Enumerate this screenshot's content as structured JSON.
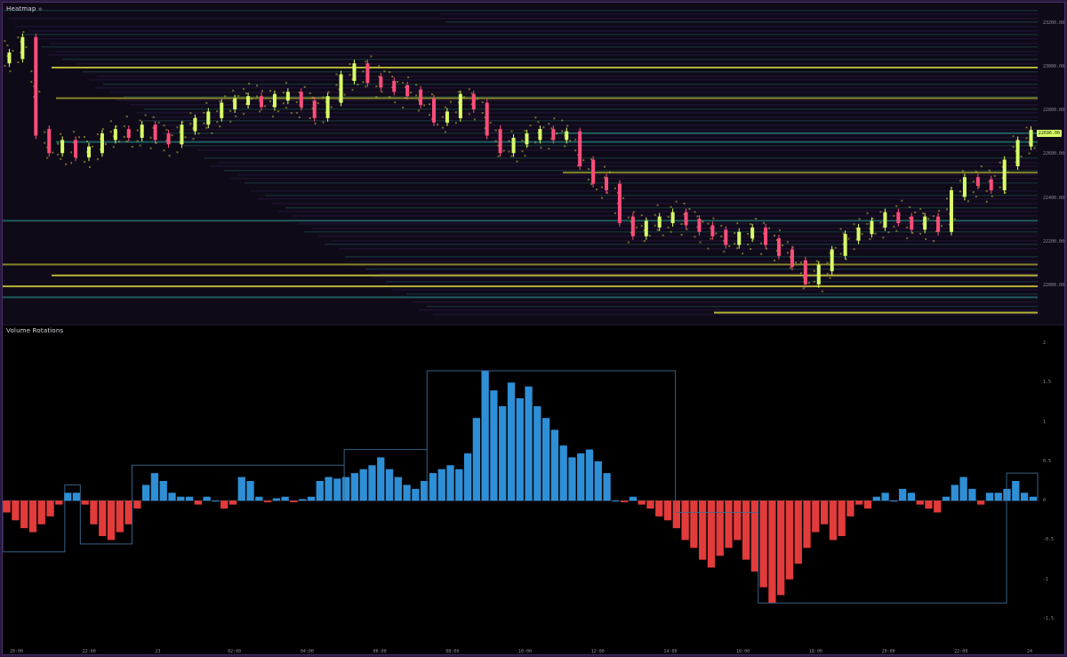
{
  "heatmap": {
    "title": "Heatmap",
    "title_icon": "settings-icon",
    "price_axis": [
      "23200.00",
      "23000.00",
      "22800.00",
      "22600.00",
      "22400.00",
      "22200.00",
      "22000.00"
    ],
    "current_price": "22696.00",
    "colors": {
      "background": "#0f0a18",
      "liquidity_low": "#3b1f5c",
      "liquidity_mid": "#1f6b6b",
      "liquidity_high": "#d4d23a",
      "bull_candle": "#d9ff66",
      "bear_candle": "#ff4d7a"
    },
    "liquidity_levels": [
      {
        "price": 23000,
        "strength": 0.8
      },
      {
        "price": 22860,
        "strength": 0.6
      },
      {
        "price": 22520,
        "strength": 0.5
      },
      {
        "price": 22100,
        "strength": 0.5
      },
      {
        "price": 22050,
        "strength": 0.9
      },
      {
        "price": 22000,
        "strength": 1.0
      },
      {
        "price": 21950,
        "strength": 0.4
      },
      {
        "price": 21880,
        "strength": 0.9
      },
      {
        "price": 22660,
        "strength": 0.4
      },
      {
        "price": 22300,
        "strength": 0.3
      },
      {
        "price": 22700,
        "strength": 0.2
      }
    ],
    "price_series": [
      23050,
      23120,
      22700,
      22620,
      22650,
      22600,
      22620,
      22680,
      22700,
      22690,
      22720,
      22680,
      22660,
      22720,
      22750,
      22780,
      22820,
      22840,
      22850,
      22830,
      22860,
      22870,
      22830,
      22780,
      22850,
      22950,
      23000,
      22940,
      22920,
      22900,
      22880,
      22840,
      22760,
      22780,
      22860,
      22820,
      22700,
      22620,
      22660,
      22680,
      22700,
      22680,
      22690,
      22560,
      22480,
      22450,
      22300,
      22240,
      22280,
      22300,
      22320,
      22290,
      22260,
      22240,
      22200,
      22230,
      22250,
      22200,
      22150,
      22100,
      22020,
      22080,
      22150,
      22220,
      22250,
      22280,
      22320,
      22300,
      22270,
      22300,
      22260,
      22420,
      22480,
      22470,
      22450,
      22560,
      22650,
      22696
    ]
  },
  "volume": {
    "title": "Volume Rotations",
    "y_axis": [
      "2",
      "1.5",
      "1",
      "0.5",
      "0",
      "-0.5",
      "-1",
      "-1.5"
    ],
    "colors": {
      "positive": "#2e8fd6",
      "negative": "#e23b3b",
      "rotation_line_pos": "#2f6f9f",
      "rotation_line_neg": "#8a2a2a"
    },
    "bars": [
      -0.15,
      -0.25,
      -0.35,
      -0.4,
      -0.3,
      -0.2,
      -0.05,
      0.1,
      0.1,
      -0.05,
      -0.3,
      -0.45,
      -0.5,
      -0.4,
      -0.3,
      -0.1,
      0.2,
      0.35,
      0.25,
      0.1,
      0.05,
      0.05,
      -0.05,
      0.05,
      0.0,
      -0.1,
      -0.05,
      0.3,
      0.25,
      0.05,
      -0.02,
      0.03,
      0.05,
      -0.02,
      0.02,
      0.05,
      0.25,
      0.3,
      0.28,
      0.3,
      0.35,
      0.4,
      0.45,
      0.55,
      0.4,
      0.3,
      0.2,
      0.15,
      0.25,
      0.35,
      0.4,
      0.45,
      0.4,
      0.6,
      1.05,
      1.65,
      1.4,
      1.2,
      1.5,
      1.3,
      1.45,
      1.2,
      1.05,
      0.9,
      0.7,
      0.55,
      0.6,
      0.65,
      0.5,
      0.35,
      0.0,
      -0.02,
      0.05,
      -0.05,
      -0.1,
      -0.2,
      -0.25,
      -0.35,
      -0.5,
      -0.6,
      -0.75,
      -0.85,
      -0.7,
      -0.6,
      -0.5,
      -0.75,
      -0.9,
      -1.1,
      -1.3,
      -1.2,
      -1.0,
      -0.8,
      -0.6,
      -0.4,
      -0.3,
      -0.5,
      -0.45,
      -0.2,
      -0.05,
      -0.1,
      0.05,
      0.1,
      0.0,
      0.15,
      0.1,
      -0.05,
      -0.1,
      -0.15,
      0.05,
      0.2,
      0.3,
      0.15,
      -0.05,
      0.1,
      0.1,
      0.15,
      0.25,
      0.1,
      0.05
    ],
    "rotation_steps": [
      {
        "from": 0.0,
        "to": 0.06,
        "level": -0.65
      },
      {
        "from": 0.06,
        "to": 0.075,
        "level": 0.2
      },
      {
        "from": 0.075,
        "to": 0.125,
        "level": -0.55
      },
      {
        "from": 0.125,
        "to": 0.33,
        "level": 0.45
      },
      {
        "from": 0.33,
        "to": 0.41,
        "level": 0.65
      },
      {
        "from": 0.41,
        "to": 0.65,
        "level": 1.65
      },
      {
        "from": 0.65,
        "to": 0.73,
        "level": -0.15
      },
      {
        "from": 0.73,
        "to": 0.97,
        "level": -1.3
      },
      {
        "from": 0.97,
        "to": 1.0,
        "level": 0.35
      }
    ],
    "y_min": -1.5,
    "y_max": 2.0
  },
  "time_axis": [
    "20:00",
    "22:00",
    "23",
    "02:00",
    "04:00",
    "06:00",
    "08:00",
    "10:00",
    "12:00",
    "14:00",
    "16:00",
    "18:00",
    "20:00",
    "22:00",
    "24"
  ]
}
